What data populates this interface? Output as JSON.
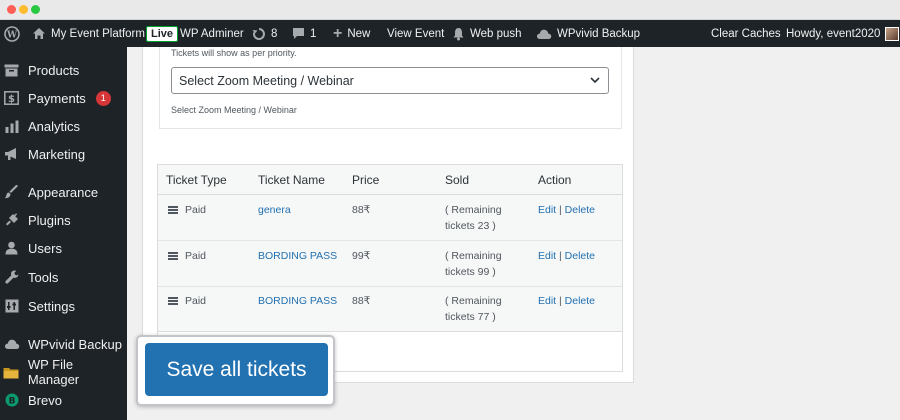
{
  "adminbar": {
    "site_name": "My Event Platform",
    "live_badge": "Live",
    "wp_adminer": "WP Adminer",
    "updates_count": "8",
    "comments_count": "1",
    "new_label": "New",
    "view_event": "View Event",
    "web_push": "Web push",
    "wpvivid_backup": "WPvivid Backup",
    "clear_caches": "Clear Caches",
    "howdy": "Howdy, event2020"
  },
  "sidebar": {
    "items": [
      {
        "label": "Products",
        "icon": "archive-icon"
      },
      {
        "label": "Payments",
        "icon": "dollar-icon",
        "badge": "1"
      },
      {
        "label": "Analytics",
        "icon": "bar-chart-icon"
      },
      {
        "label": "Marketing",
        "icon": "megaphone-icon"
      },
      {
        "label": "Appearance",
        "icon": "paintbrush-icon"
      },
      {
        "label": "Plugins",
        "icon": "plug-icon"
      },
      {
        "label": "Users",
        "icon": "user-icon"
      },
      {
        "label": "Tools",
        "icon": "wrench-icon"
      },
      {
        "label": "Settings",
        "icon": "sliders-icon"
      },
      {
        "label": "WPvivid Backup",
        "icon": "cloud-icon"
      },
      {
        "label": "WP File Manager",
        "icon": "folder-icon"
      },
      {
        "label": "Brevo",
        "icon": "brevo-logo-icon"
      }
    ]
  },
  "zoom": {
    "priority_note": "Tickets will show as per priority.",
    "select_value": "Select Zoom Meeting / Webinar",
    "help_text": "Select Zoom Meeting / Webinar"
  },
  "tickets": {
    "headers": {
      "type": "Ticket Type",
      "name": "Ticket Name",
      "price": "Price",
      "sold": "Sold",
      "action": "Action"
    },
    "rows": [
      {
        "type": "Paid",
        "name": "genera",
        "price": "88₹",
        "sold_line1": "( Remaining",
        "sold_line2": "tickets 23 )"
      },
      {
        "type": "Paid",
        "name": "BORDING PASS",
        "price": "99₹",
        "sold_line1": "( Remaining",
        "sold_line2": "tickets 99 )"
      },
      {
        "type": "Paid",
        "name": "BORDING PASS",
        "price": "88₹",
        "sold_line1": "( Remaining",
        "sold_line2": "tickets 77 )"
      }
    ],
    "edit_label": "Edit",
    "separator": "|",
    "delete_label": "Delete"
  },
  "save_button": "Save all tickets",
  "colors": {
    "admin_dark": "#1d2327",
    "accent_blue": "#2271b1",
    "badge_red": "#d63638"
  }
}
